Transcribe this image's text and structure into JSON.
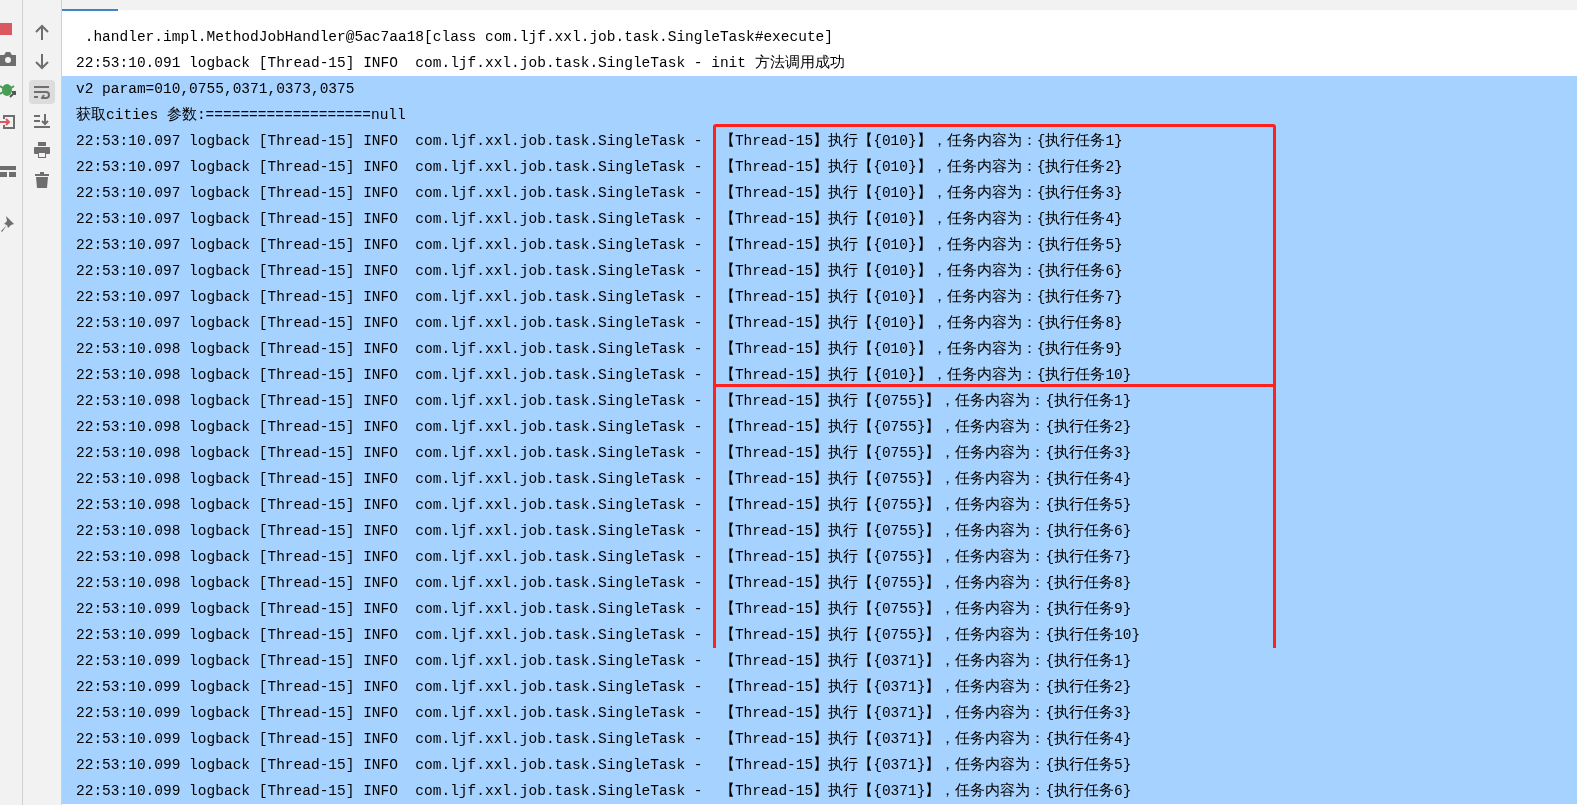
{
  "toolbar": {
    "soft_wrap_on": true
  },
  "console": {
    "lines": [
      {
        "text": " .handler.impl.MethodJobHandler@5ac7aa18[class com.ljf.xxl.job.task.SingleTask#execute]",
        "selected": false
      },
      {
        "text": "22:53:10.091 logback [Thread-15] INFO  com.ljf.xxl.job.task.SingleTask - init 方法调用成功",
        "selected": false
      },
      {
        "text": "v2 param=010,0755,0371,0373,0375",
        "selected": true
      },
      {
        "text": "获取cities 参数:===================null",
        "selected": true
      }
    ],
    "groups": [
      {
        "boxed": true,
        "lines": [
          {
            "text": "22:53:10.097 logback [Thread-15] INFO  com.ljf.xxl.job.task.SingleTask -",
            "message": "【Thread-15】执行【{010}】，任务内容为：{执行任务1}",
            "selected": true
          },
          {
            "text": "22:53:10.097 logback [Thread-15] INFO  com.ljf.xxl.job.task.SingleTask -",
            "message": "【Thread-15】执行【{010}】，任务内容为：{执行任务2}",
            "selected": true
          },
          {
            "text": "22:53:10.097 logback [Thread-15] INFO  com.ljf.xxl.job.task.SingleTask -",
            "message": "【Thread-15】执行【{010}】，任务内容为：{执行任务3}",
            "selected": true
          },
          {
            "text": "22:53:10.097 logback [Thread-15] INFO  com.ljf.xxl.job.task.SingleTask -",
            "message": "【Thread-15】执行【{010}】，任务内容为：{执行任务4}",
            "selected": true
          },
          {
            "text": "22:53:10.097 logback [Thread-15] INFO  com.ljf.xxl.job.task.SingleTask -",
            "message": "【Thread-15】执行【{010}】，任务内容为：{执行任务5}",
            "selected": true
          },
          {
            "text": "22:53:10.097 logback [Thread-15] INFO  com.ljf.xxl.job.task.SingleTask -",
            "message": "【Thread-15】执行【{010}】，任务内容为：{执行任务6}",
            "selected": true
          },
          {
            "text": "22:53:10.097 logback [Thread-15] INFO  com.ljf.xxl.job.task.SingleTask -",
            "message": "【Thread-15】执行【{010}】，任务内容为：{执行任务7}",
            "selected": true
          },
          {
            "text": "22:53:10.097 logback [Thread-15] INFO  com.ljf.xxl.job.task.SingleTask -",
            "message": "【Thread-15】执行【{010}】，任务内容为：{执行任务8}",
            "selected": true
          },
          {
            "text": "22:53:10.098 logback [Thread-15] INFO  com.ljf.xxl.job.task.SingleTask -",
            "message": "【Thread-15】执行【{010}】，任务内容为：{执行任务9}",
            "selected": true
          },
          {
            "text": "22:53:10.098 logback [Thread-15] INFO  com.ljf.xxl.job.task.SingleTask -",
            "message": "【Thread-15】执行【{010}】，任务内容为：{执行任务10}",
            "selected": true
          }
        ]
      },
      {
        "boxed": true,
        "lines": [
          {
            "text": "22:53:10.098 logback [Thread-15] INFO  com.ljf.xxl.job.task.SingleTask -",
            "message": "【Thread-15】执行【{0755}】，任务内容为：{执行任务1}",
            "selected": true
          },
          {
            "text": "22:53:10.098 logback [Thread-15] INFO  com.ljf.xxl.job.task.SingleTask -",
            "message": "【Thread-15】执行【{0755}】，任务内容为：{执行任务2}",
            "selected": true
          },
          {
            "text": "22:53:10.098 logback [Thread-15] INFO  com.ljf.xxl.job.task.SingleTask -",
            "message": "【Thread-15】执行【{0755}】，任务内容为：{执行任务3}",
            "selected": true
          },
          {
            "text": "22:53:10.098 logback [Thread-15] INFO  com.ljf.xxl.job.task.SingleTask -",
            "message": "【Thread-15】执行【{0755}】，任务内容为：{执行任务4}",
            "selected": true
          },
          {
            "text": "22:53:10.098 logback [Thread-15] INFO  com.ljf.xxl.job.task.SingleTask -",
            "message": "【Thread-15】执行【{0755}】，任务内容为：{执行任务5}",
            "selected": true
          },
          {
            "text": "22:53:10.098 logback [Thread-15] INFO  com.ljf.xxl.job.task.SingleTask -",
            "message": "【Thread-15】执行【{0755}】，任务内容为：{执行任务6}",
            "selected": true
          },
          {
            "text": "22:53:10.098 logback [Thread-15] INFO  com.ljf.xxl.job.task.SingleTask -",
            "message": "【Thread-15】执行【{0755}】，任务内容为：{执行任务7}",
            "selected": true
          },
          {
            "text": "22:53:10.098 logback [Thread-15] INFO  com.ljf.xxl.job.task.SingleTask -",
            "message": "【Thread-15】执行【{0755}】，任务内容为：{执行任务8}",
            "selected": true
          },
          {
            "text": "22:53:10.099 logback [Thread-15] INFO  com.ljf.xxl.job.task.SingleTask -",
            "message": "【Thread-15】执行【{0755}】，任务内容为：{执行任务9}",
            "selected": true
          },
          {
            "text": "22:53:10.099 logback [Thread-15] INFO  com.ljf.xxl.job.task.SingleTask -",
            "message": "【Thread-15】执行【{0755}】，任务内容为：{执行任务10}",
            "selected": true
          }
        ]
      },
      {
        "boxed": false,
        "lines": [
          {
            "text": "22:53:10.099 logback [Thread-15] INFO  com.ljf.xxl.job.task.SingleTask -",
            "message": "【Thread-15】执行【{0371}】，任务内容为：{执行任务1}",
            "selected": true
          },
          {
            "text": "22:53:10.099 logback [Thread-15] INFO  com.ljf.xxl.job.task.SingleTask -",
            "message": "【Thread-15】执行【{0371}】，任务内容为：{执行任务2}",
            "selected": true
          },
          {
            "text": "22:53:10.099 logback [Thread-15] INFO  com.ljf.xxl.job.task.SingleTask -",
            "message": "【Thread-15】执行【{0371}】，任务内容为：{执行任务3}",
            "selected": true
          },
          {
            "text": "22:53:10.099 logback [Thread-15] INFO  com.ljf.xxl.job.task.SingleTask -",
            "message": "【Thread-15】执行【{0371}】，任务内容为：{执行任务4}",
            "selected": true
          },
          {
            "text": "22:53:10.099 logback [Thread-15] INFO  com.ljf.xxl.job.task.SingleTask -",
            "message": "【Thread-15】执行【{0371}】，任务内容为：{执行任务5}",
            "selected": true
          },
          {
            "text": "22:53:10.099 logback [Thread-15] INFO  com.ljf.xxl.job.task.SingleTask -",
            "message": "【Thread-15】执行【{0371}】，任务内容为：{执行任务6}",
            "selected": true
          }
        ]
      }
    ]
  }
}
